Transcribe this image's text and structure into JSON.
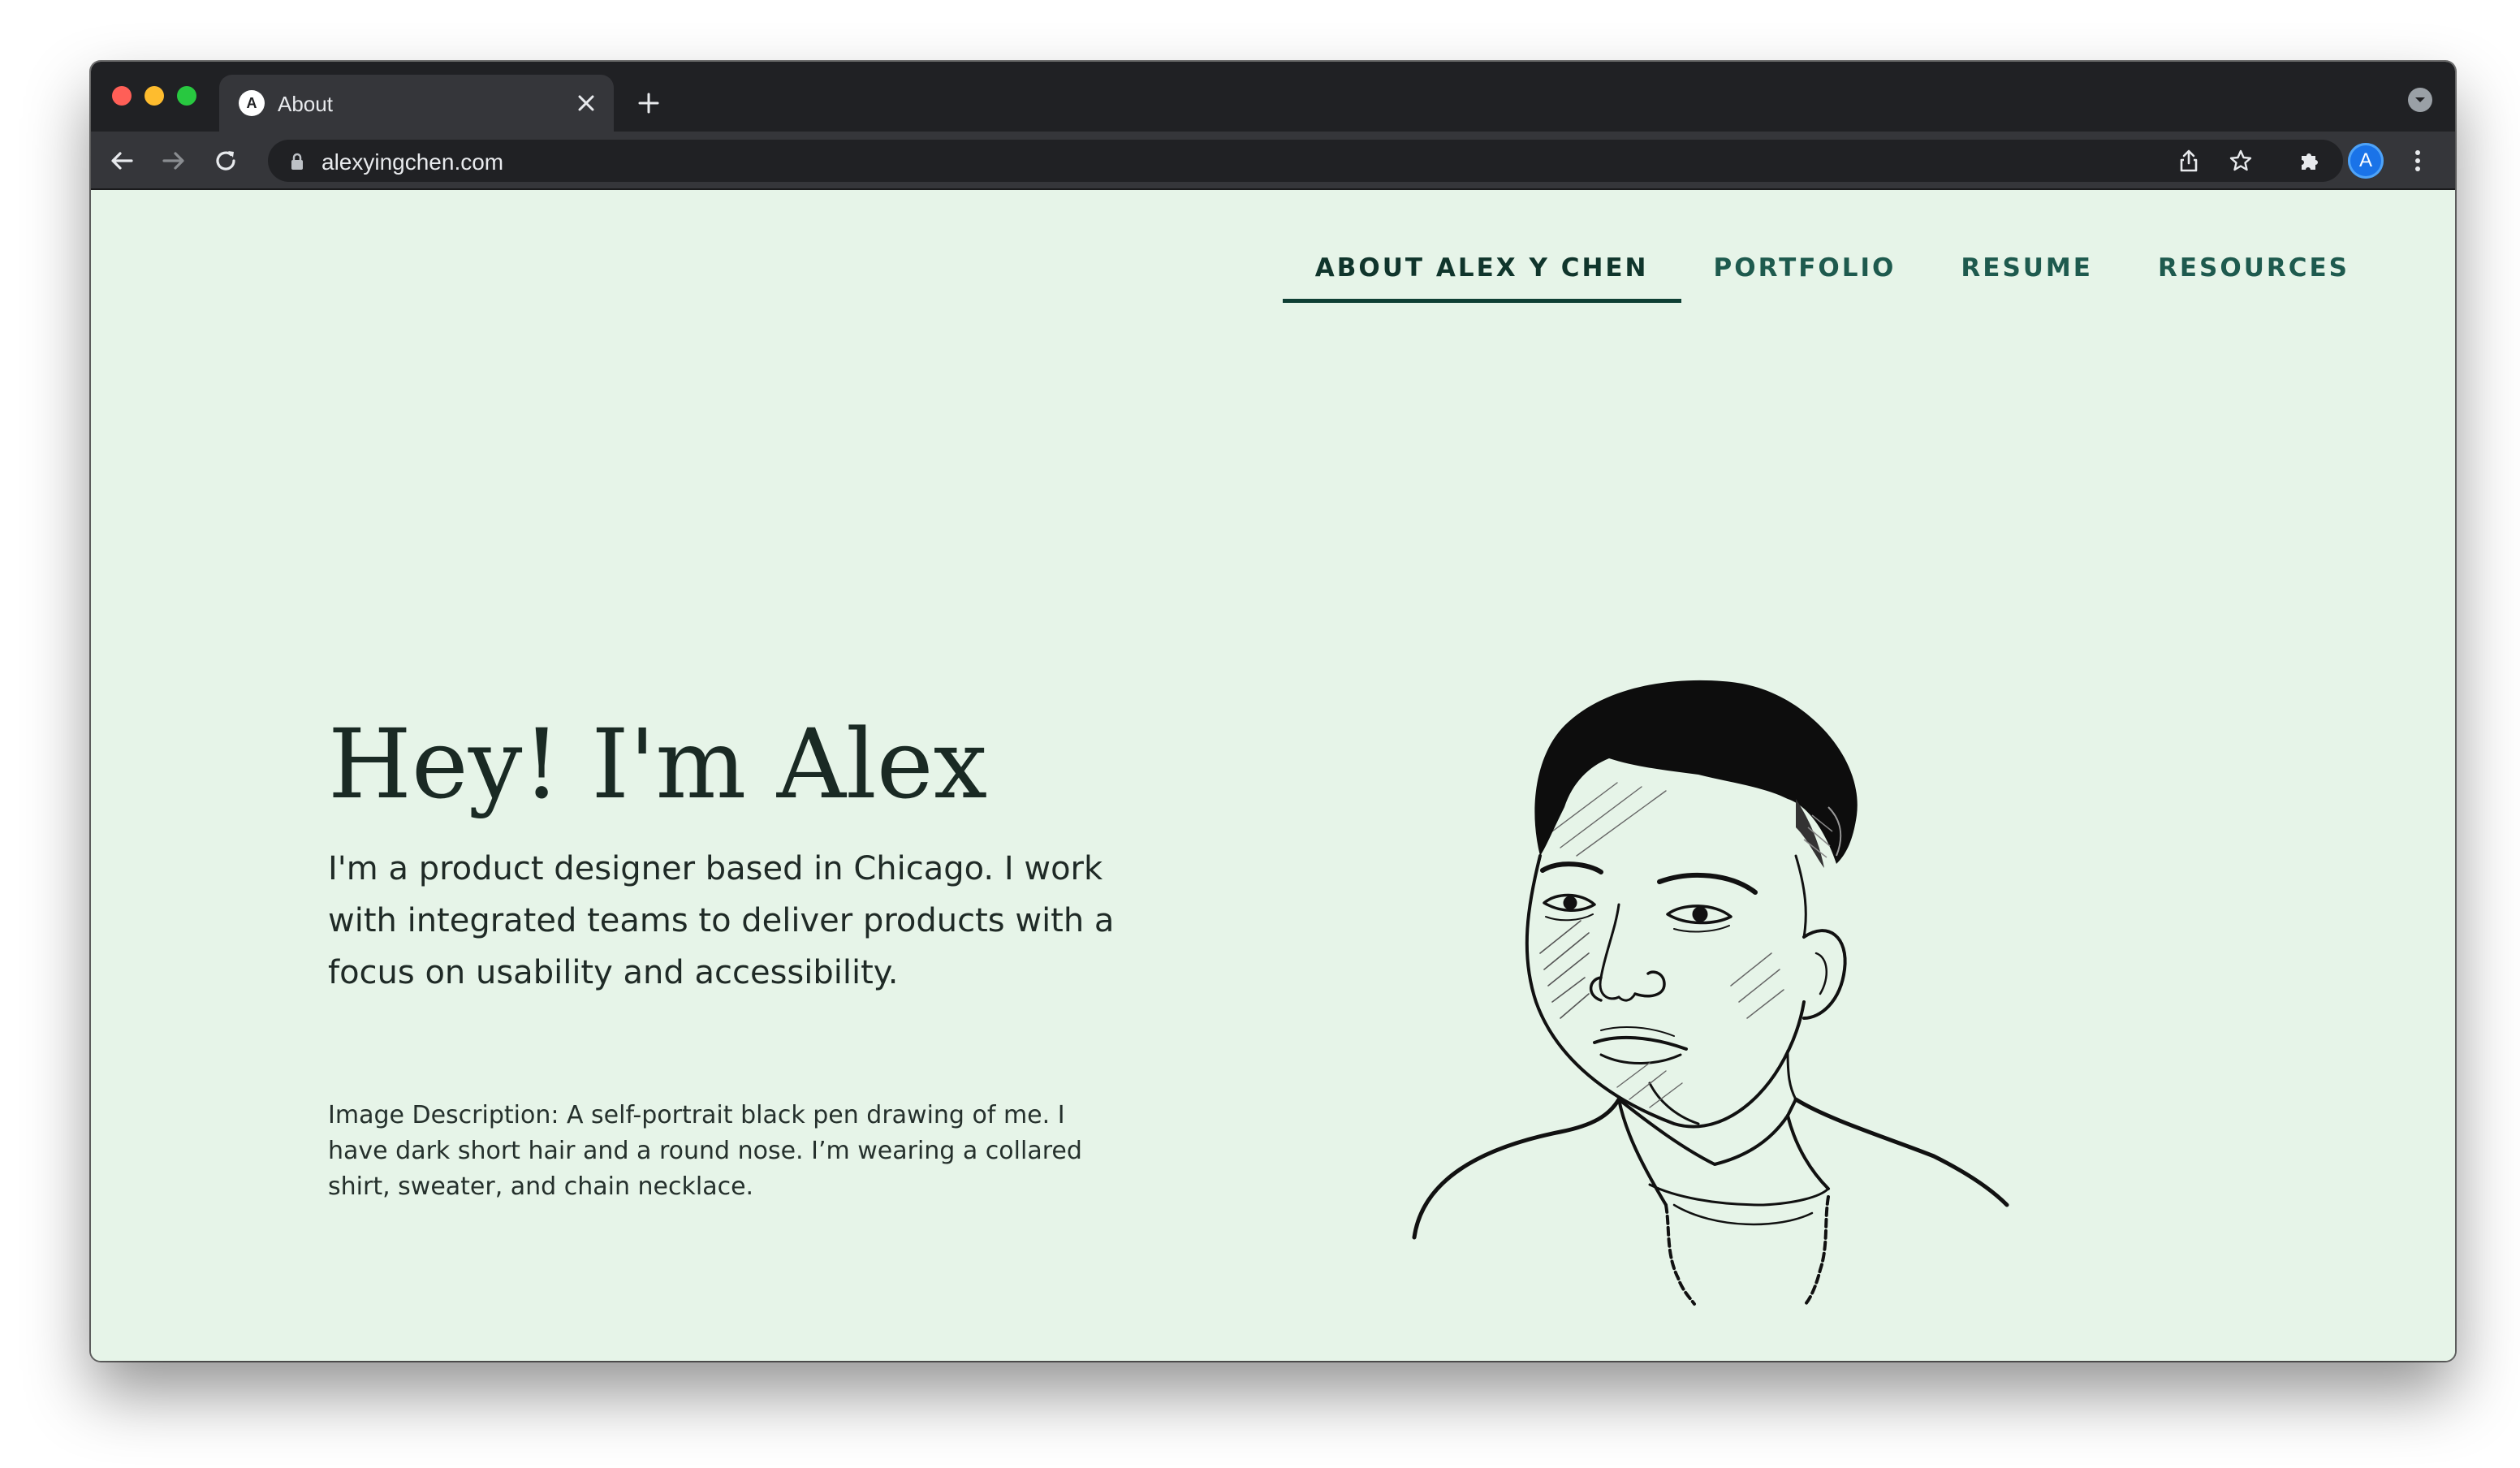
{
  "browser": {
    "tab": {
      "favicon_letter": "A",
      "title": "About"
    },
    "address_bar": {
      "url": "alexyingchen.com"
    },
    "profile_initial": "A",
    "icons": {
      "back": "back-arrow-icon",
      "forward": "forward-arrow-icon",
      "reload": "reload-icon",
      "lock": "lock-icon",
      "share": "share-icon",
      "bookmark": "star-icon",
      "extensions": "puzzle-icon",
      "menu": "kebab-menu-icon",
      "tab_search": "chevron-down-icon",
      "close_tab": "close-icon",
      "new_tab": "plus-icon"
    },
    "colors": {
      "chrome_dark": "#202124",
      "chrome_toolbar": "#35363a",
      "profile_blue": "#1a73e8"
    }
  },
  "site": {
    "nav": [
      {
        "label": "ABOUT ALEX Y CHEN",
        "active": true
      },
      {
        "label": "PORTFOLIO",
        "active": false
      },
      {
        "label": "RESUME",
        "active": false
      },
      {
        "label": "RESOURCES",
        "active": false
      }
    ],
    "hero": {
      "title": "Hey! I'm Alex",
      "intro": "I'm a product designer based in Chicago. I work with integrated teams to deliver products with a focus on usability and accessibility.",
      "image_description": "Image Description: A self-portrait black pen drawing of me. I have dark short hair and a round nose. I’m wearing a collared shirt, sweater, and chain necklace."
    },
    "colors": {
      "background": "#e6f4e8",
      "nav_text": "#1e5a4e",
      "nav_active_underline": "#0f3f34",
      "heading": "#1a2a24"
    }
  }
}
